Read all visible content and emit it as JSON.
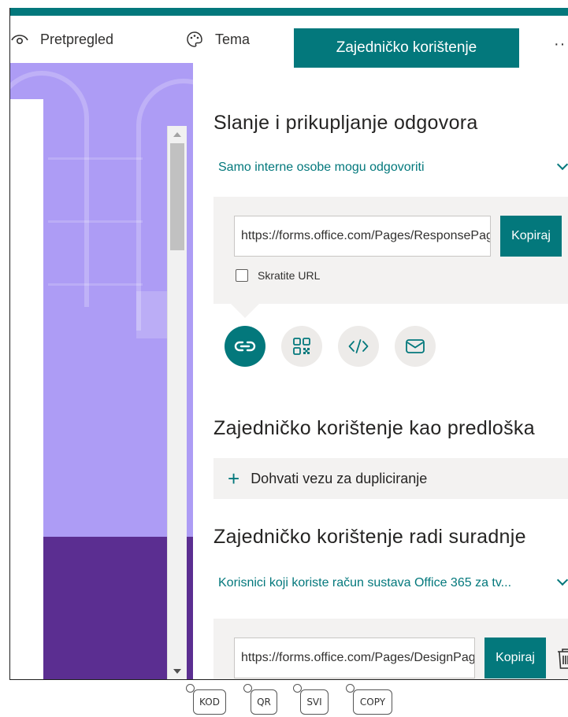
{
  "toolbar": {
    "preview_label": "Pretpregled",
    "theme_label": "Tema",
    "share_label": "Zajedničko korištenje",
    "more_label": "··"
  },
  "send": {
    "title": "Slanje i prikupljanje odgovora",
    "permission": "Samo interne osobe mogu odgovoriti",
    "url": "https://forms.office.com/Pages/ResponsePage.aspx",
    "copy_label": "Kopiraj",
    "shorten_label": "Skratite URL",
    "shorten_checked": false,
    "share_options": [
      "link-icon",
      "qr-code-icon",
      "embed-code-icon",
      "email-icon"
    ],
    "active_option": "link-icon"
  },
  "template": {
    "title": "Zajedničko korištenje kao predloška",
    "duplicate_label": "Dohvati vezu za dupliciranje"
  },
  "collab": {
    "title": "Zajedničko korištenje radi suradnje",
    "permission": "Korisnici koji koriste račun sustava Office 365 za tv...",
    "url": "https://forms.office.com/Pages/DesignPage.aspx",
    "copy_label": "Kopiraj"
  },
  "bottom_tags": [
    "KOD",
    "QR",
    "SVI",
    "COPY"
  ],
  "colors": {
    "accent": "#03787c",
    "preview_background": "#ad9cf5",
    "preview_band": "#5b2e91",
    "panel_background": "#f3f2f1"
  }
}
